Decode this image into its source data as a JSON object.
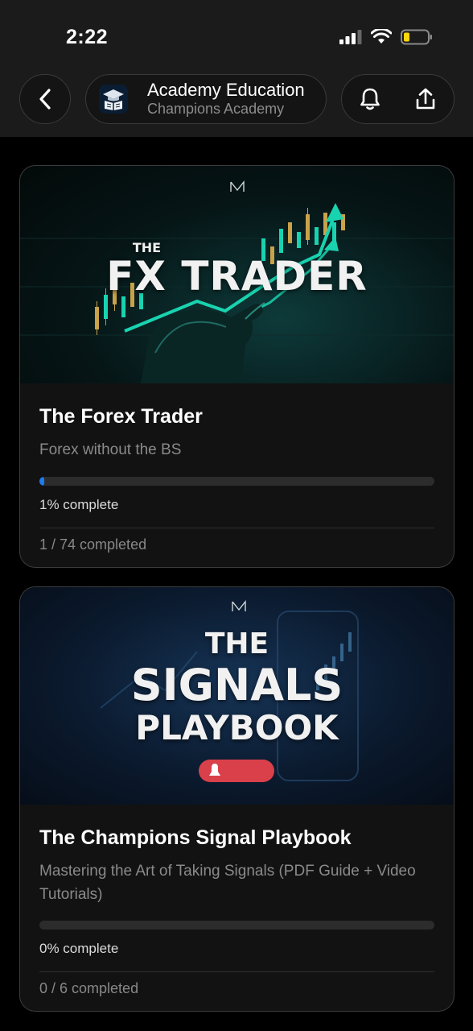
{
  "status_bar": {
    "time": "2:22"
  },
  "header": {
    "title": "Academy Education",
    "subtitle": "Champions Academy",
    "icons": {
      "back": "chevron-left-icon",
      "app": "graduation-cap-book-icon",
      "notifications": "bell-icon",
      "share": "share-upload-icon"
    }
  },
  "courses": [
    {
      "thumb_top": "THE",
      "thumb_main": "FX TRADER",
      "title": "The Forex Trader",
      "description": "Forex without the BS",
      "progress": 0.01,
      "progress_text": "1% complete",
      "count_text": "1 / 74 completed"
    },
    {
      "thumb_top": "THE",
      "thumb_main": "SIGNALS",
      "thumb_sub": "PLAYBOOK",
      "title": "The Champions Signal Playbook",
      "description": "Mastering the Art of Taking Signals (PDF Guide + Video Tutorials)",
      "progress": 0,
      "progress_text": "0% complete",
      "count_text": "0 / 6 completed"
    }
  ],
  "colors": {
    "accent": "#1e7cf2",
    "teal": "#19d3b0",
    "candle_gold": "#c9a24a",
    "badge_red": "#d9404a"
  }
}
